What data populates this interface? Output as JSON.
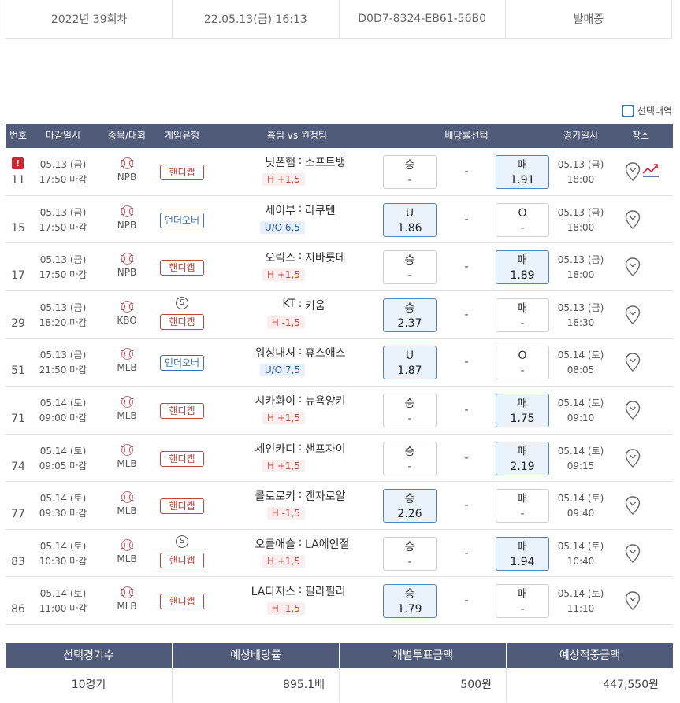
{
  "info": {
    "round": "2022년 39회차",
    "datetime": "22.05.13(금) 16:13",
    "code": "D0D7-8324-EB61-56B0",
    "status": "발매중"
  },
  "select_history_label": "선택내역",
  "headers": {
    "no": "번호",
    "deadline": "마감일시",
    "sport": "종목/대회",
    "game_type": "게임유형",
    "match": "홈팀 vs 원정팀",
    "odds_select": "배당률선택",
    "game_time": "경기일시",
    "venue": "장소"
  },
  "games": [
    {
      "no": "11",
      "alert": "!",
      "deadline_date": "05.13 (금)",
      "deadline_time": "17:50 마감",
      "league": "NPB",
      "s": "",
      "type": "핸디캡",
      "home": "닛폰햄",
      "away": "소프트뱅",
      "hval": "H +1,5",
      "o1_label": "승",
      "o1_val": "-",
      "draw": "-",
      "o2_label": "패",
      "o2_val": "1.91",
      "sel": "2",
      "game_date": "05.13 (금)",
      "game_time": "18:00"
    },
    {
      "no": "15",
      "alert": "",
      "deadline_date": "05.13 (금)",
      "deadline_time": "17:50 마감",
      "league": "NPB",
      "s": "",
      "type": "언더오버",
      "home": "세이부",
      "away": "라쿠텐",
      "hval": "U/O 6,5",
      "o1_label": "U",
      "o1_val": "1.86",
      "draw": "-",
      "o2_label": "O",
      "o2_val": "-",
      "sel": "1",
      "game_date": "05.13 (금)",
      "game_time": "18:00"
    },
    {
      "no": "17",
      "alert": "",
      "deadline_date": "05.13 (금)",
      "deadline_time": "17:50 마감",
      "league": "NPB",
      "s": "",
      "type": "핸디캡",
      "home": "오릭스",
      "away": "지바롯데",
      "hval": "H +1,5",
      "o1_label": "승",
      "o1_val": "-",
      "draw": "-",
      "o2_label": "패",
      "o2_val": "1.89",
      "sel": "2",
      "game_date": "05.13 (금)",
      "game_time": "18:00"
    },
    {
      "no": "29",
      "alert": "",
      "deadline_date": "05.13 (금)",
      "deadline_time": "18:20 마감",
      "league": "KBO",
      "s": "S",
      "type": "핸디캡",
      "home": "KT",
      "away": "키움",
      "hval": "H -1,5",
      "o1_label": "승",
      "o1_val": "2.37",
      "draw": "-",
      "o2_label": "패",
      "o2_val": "-",
      "sel": "1",
      "game_date": "05.13 (금)",
      "game_time": "18:30"
    },
    {
      "no": "51",
      "alert": "",
      "deadline_date": "05.13 (금)",
      "deadline_time": "21:50 마감",
      "league": "MLB",
      "s": "",
      "type": "언더오버",
      "home": "워싱내셔",
      "away": "휴스애스",
      "hval": "U/O 7,5",
      "o1_label": "U",
      "o1_val": "1.87",
      "draw": "-",
      "o2_label": "O",
      "o2_val": "-",
      "sel": "1",
      "game_date": "05.14 (토)",
      "game_time": "08:05"
    },
    {
      "no": "71",
      "alert": "",
      "deadline_date": "05.14 (토)",
      "deadline_time": "09:00 마감",
      "league": "MLB",
      "s": "",
      "type": "핸디캡",
      "home": "시카화이",
      "away": "뉴욕양키",
      "hval": "H +1,5",
      "o1_label": "승",
      "o1_val": "-",
      "draw": "-",
      "o2_label": "패",
      "o2_val": "1.75",
      "sel": "2",
      "game_date": "05.14 (토)",
      "game_time": "09:10"
    },
    {
      "no": "74",
      "alert": "",
      "deadline_date": "05.14 (토)",
      "deadline_time": "09:05 마감",
      "league": "MLB",
      "s": "",
      "type": "핸디캡",
      "home": "세인카디",
      "away": "샌프자이",
      "hval": "H +1,5",
      "o1_label": "승",
      "o1_val": "-",
      "draw": "-",
      "o2_label": "패",
      "o2_val": "2.19",
      "sel": "2",
      "game_date": "05.14 (토)",
      "game_time": "09:15"
    },
    {
      "no": "77",
      "alert": "",
      "deadline_date": "05.14 (토)",
      "deadline_time": "09:30 마감",
      "league": "MLB",
      "s": "",
      "type": "핸디캡",
      "home": "콜로로키",
      "away": "캔자로얄",
      "hval": "H -1,5",
      "o1_label": "승",
      "o1_val": "2.26",
      "draw": "-",
      "o2_label": "패",
      "o2_val": "-",
      "sel": "1",
      "game_date": "05.14 (토)",
      "game_time": "09:40"
    },
    {
      "no": "83",
      "alert": "",
      "deadline_date": "05.14 (토)",
      "deadline_time": "10:30 마감",
      "league": "MLB",
      "s": "S",
      "type": "핸디캡",
      "home": "오클애슬",
      "away": "LA에인절",
      "hval": "H +1,5",
      "o1_label": "승",
      "o1_val": "-",
      "draw": "-",
      "o2_label": "패",
      "o2_val": "1.94",
      "sel": "2",
      "game_date": "05.14 (토)",
      "game_time": "10:40"
    },
    {
      "no": "86",
      "alert": "",
      "deadline_date": "05.14 (토)",
      "deadline_time": "11:00 마감",
      "league": "MLB",
      "s": "",
      "type": "핸디캡",
      "home": "LA다저스",
      "away": "필라필리",
      "hval": "H -1,5",
      "o1_label": "승",
      "o1_val": "1.79",
      "draw": "-",
      "o2_label": "패",
      "o2_val": "-",
      "sel": "1",
      "game_date": "05.14 (토)",
      "game_time": "11:10"
    }
  ],
  "summary": {
    "headers": [
      "선택경기수",
      "예상배당률",
      "개별투표금액",
      "예상적중금액"
    ],
    "values": [
      "10경기",
      "895.1배",
      "500원",
      "447,550원"
    ]
  },
  "colors": {
    "header_bg": "#505b7a",
    "handicap": "#c0453c",
    "underover": "#3b6fb0",
    "selected_bg": "#eaf3fc",
    "alert": "#d0262d"
  }
}
